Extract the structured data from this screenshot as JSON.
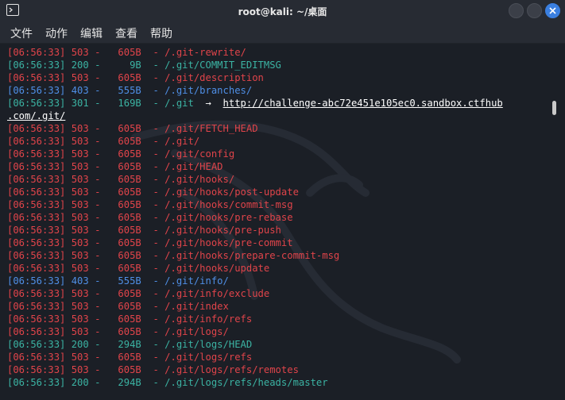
{
  "window": {
    "title": "root@kali: ~/桌面"
  },
  "menu": {
    "items": [
      "文件",
      "动作",
      "编辑",
      "查看",
      "帮助"
    ]
  },
  "terminal": {
    "lines": [
      {
        "color": "red",
        "time": "[06:56:33]",
        "code": "503",
        "size": "605B",
        "path": "/.git-rewrite/"
      },
      {
        "color": "cyan",
        "time": "[06:56:33]",
        "code": "200",
        "size": "9B",
        "path": "/.git/COMMIT_EDITMSG"
      },
      {
        "color": "red",
        "time": "[06:56:33]",
        "code": "503",
        "size": "605B",
        "path": "/.git/description"
      },
      {
        "color": "blue",
        "time": "[06:56:33]",
        "code": "403",
        "size": "555B",
        "path": "/.git/branches/"
      },
      {
        "color": "cyan",
        "time": "[06:56:33]",
        "code": "301",
        "size": "169B",
        "path": "/.git",
        "arrow": "→",
        "url": "http://challenge-abc72e451e105ec0.sandbox.ctfhub"
      },
      {
        "color": "wrap",
        "text": ".com/.git/"
      },
      {
        "color": "red",
        "time": "[06:56:33]",
        "code": "503",
        "size": "605B",
        "path": "/.git/FETCH_HEAD"
      },
      {
        "color": "red",
        "time": "[06:56:33]",
        "code": "503",
        "size": "605B",
        "path": "/.git/"
      },
      {
        "color": "red",
        "time": "[06:56:33]",
        "code": "503",
        "size": "605B",
        "path": "/.git/config"
      },
      {
        "color": "red",
        "time": "[06:56:33]",
        "code": "503",
        "size": "605B",
        "path": "/.git/HEAD"
      },
      {
        "color": "red",
        "time": "[06:56:33]",
        "code": "503",
        "size": "605B",
        "path": "/.git/hooks/"
      },
      {
        "color": "red",
        "time": "[06:56:33]",
        "code": "503",
        "size": "605B",
        "path": "/.git/hooks/post-update"
      },
      {
        "color": "red",
        "time": "[06:56:33]",
        "code": "503",
        "size": "605B",
        "path": "/.git/hooks/commit-msg"
      },
      {
        "color": "red",
        "time": "[06:56:33]",
        "code": "503",
        "size": "605B",
        "path": "/.git/hooks/pre-rebase"
      },
      {
        "color": "red",
        "time": "[06:56:33]",
        "code": "503",
        "size": "605B",
        "path": "/.git/hooks/pre-push"
      },
      {
        "color": "red",
        "time": "[06:56:33]",
        "code": "503",
        "size": "605B",
        "path": "/.git/hooks/pre-commit"
      },
      {
        "color": "red",
        "time": "[06:56:33]",
        "code": "503",
        "size": "605B",
        "path": "/.git/hooks/prepare-commit-msg"
      },
      {
        "color": "red",
        "time": "[06:56:33]",
        "code": "503",
        "size": "605B",
        "path": "/.git/hooks/update"
      },
      {
        "color": "blue",
        "time": "[06:56:33]",
        "code": "403",
        "size": "555B",
        "path": "/.git/info/"
      },
      {
        "color": "red",
        "time": "[06:56:33]",
        "code": "503",
        "size": "605B",
        "path": "/.git/info/exclude"
      },
      {
        "color": "red",
        "time": "[06:56:33]",
        "code": "503",
        "size": "605B",
        "path": "/.git/index"
      },
      {
        "color": "red",
        "time": "[06:56:33]",
        "code": "503",
        "size": "605B",
        "path": "/.git/info/refs"
      },
      {
        "color": "red",
        "time": "[06:56:33]",
        "code": "503",
        "size": "605B",
        "path": "/.git/logs/"
      },
      {
        "color": "cyan",
        "time": "[06:56:33]",
        "code": "200",
        "size": "294B",
        "path": "/.git/logs/HEAD"
      },
      {
        "color": "red",
        "time": "[06:56:33]",
        "code": "503",
        "size": "605B",
        "path": "/.git/logs/refs"
      },
      {
        "color": "red",
        "time": "[06:56:33]",
        "code": "503",
        "size": "605B",
        "path": "/.git/logs/refs/remotes"
      },
      {
        "color": "cyan",
        "time": "[06:56:33]",
        "code": "200",
        "size": "294B",
        "path": "/.git/logs/refs/heads/master"
      }
    ]
  },
  "colors": {
    "red": "#e0444a",
    "blue": "#4f8fe6",
    "cyan": "#3bb3a3",
    "background": "#1b1f26",
    "close_button": "#3a7fe0"
  },
  "icons": {
    "app": "terminal-icon",
    "minimize": "minimize-icon",
    "maximize": "maximize-icon",
    "close": "close-icon"
  }
}
